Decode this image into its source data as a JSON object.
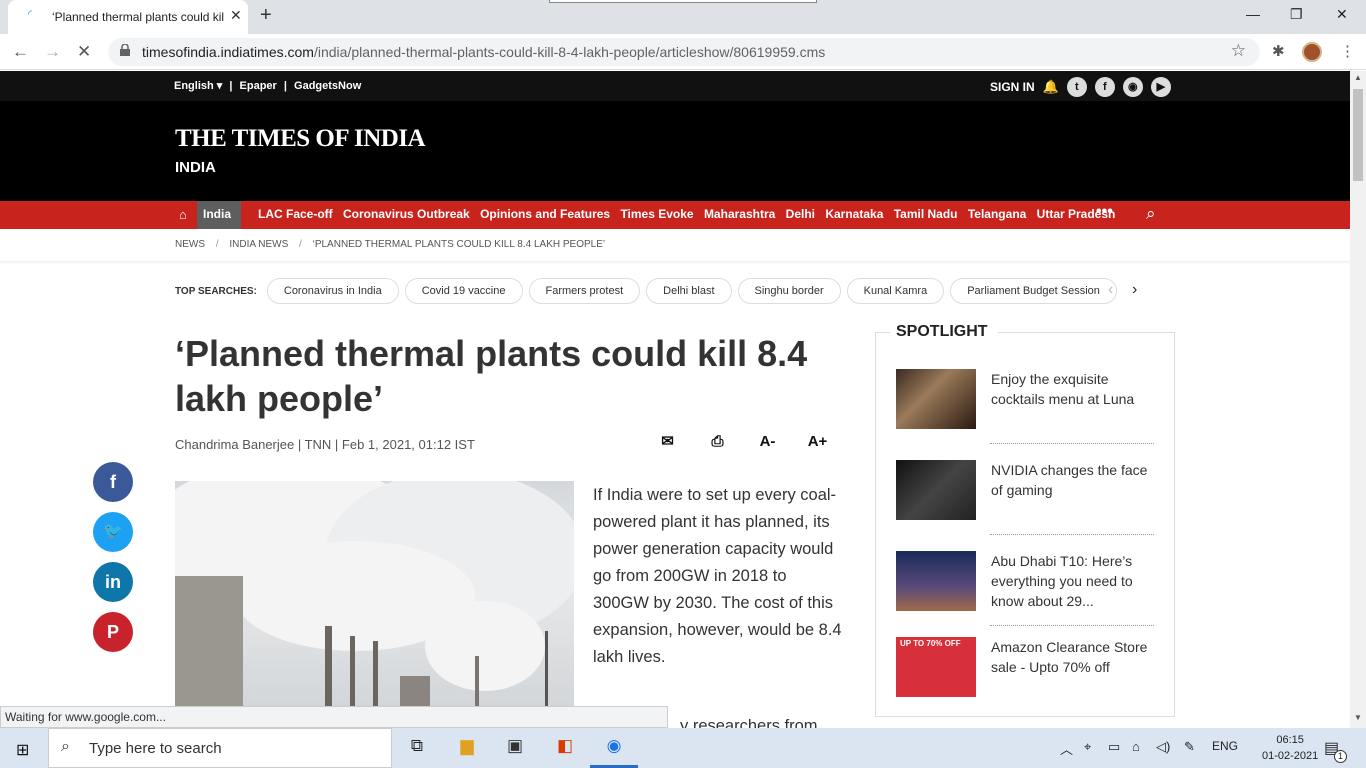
{
  "browser": {
    "tab_title": "‘Planned thermal plants could kill 8.4 lakh people’",
    "new_tab": "+",
    "url_domain": "timesofindia.indiatimes.com",
    "url_path": "/india/planned-thermal-plants-could-kill-8-4-lakh-people/articleshow/80619959.cms",
    "status_text": "Waiting for www.google.com..."
  },
  "utility": {
    "language": "English ▾",
    "sep": "|",
    "epaper": "Epaper",
    "gadgets": "GadgetsNow",
    "sign_in": "SIGN IN"
  },
  "masthead": {
    "logo": "THE TIMES OF INDIA",
    "section": "INDIA"
  },
  "nav": {
    "active": "India",
    "items": [
      "LAC Face-off",
      "Coronavirus Outbreak",
      "Opinions and Features",
      "Times Evoke",
      "Maharashtra",
      "Delhi",
      "Karnataka",
      "Tamil Nadu",
      "Telangana",
      "Uttar Pradesh"
    ],
    "more": "•••"
  },
  "breadcrumb": [
    "NEWS",
    "INDIA NEWS",
    "‘PLANNED THERMAL PLANTS COULD KILL 8.4 LAKH PEOPLE’"
  ],
  "breadcrumb_sep": "/",
  "top_searches": {
    "label": "TOP SEARCHES:",
    "chips": [
      "Coronavirus in India",
      "Covid 19 vaccine",
      "Farmers protest",
      "Delhi blast",
      "Singhu border",
      "Kunal Kamra",
      "Parliament Budget Session"
    ]
  },
  "article": {
    "headline": "‘Planned thermal plants could kill 8.4 lakh people’",
    "byline": "Chandrima Banerjee | TNN | Feb 1, 2021, 01:12 IST",
    "font_smaller": "A-",
    "font_larger": "A+",
    "paragraph1": "If India were to set up every coal-powered plant it has planned, its power generation capacity would go from 200GW in 2018 to 300GW by 2030. The cost of this expansion, however, would be 8.4 lakh lives.",
    "paragraph2_partial": "y researchers from"
  },
  "share": {
    "facebook": "f",
    "twitter": "🐦",
    "linkedin": "in",
    "pinterest": "P"
  },
  "spotlight": {
    "title": "SPOTLIGHT",
    "items": [
      {
        "text": "Enjoy the exquisite cocktails menu at Luna"
      },
      {
        "text": "NVIDIA changes the face of gaming"
      },
      {
        "text": "Abu Dhabi T10: Here’s everything you need to know about 29..."
      },
      {
        "text": "Amazon Clearance Store sale - Upto 70% off",
        "thumb_text": "UP TO 70% OFF"
      }
    ]
  },
  "taskbar": {
    "search_placeholder": "Type here to search",
    "lang": "ENG",
    "time": "06:15",
    "date": "01-02-2021",
    "notif_count": "1"
  },
  "colors": {
    "nav_red": "#c8241d",
    "masthead_bg": "#000000",
    "facebook": "#3b5998",
    "twitter": "#1da1f2",
    "linkedin": "#0e76a8",
    "pinterest": "#c8232c"
  }
}
